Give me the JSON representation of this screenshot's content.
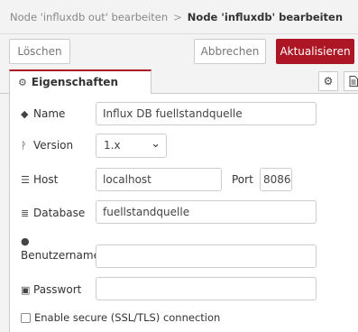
{
  "breadcrumb": {
    "parent": "Node 'influxdb out' bearbeiten",
    "separator": ">",
    "current": "Node 'influxdb' bearbeiten"
  },
  "toolbar": {
    "delete_label": "Löschen",
    "cancel_label": "Abbrechen",
    "update_label": "Aktualisieren"
  },
  "tabs": {
    "properties_label": "Eigenschaften"
  },
  "form": {
    "name_label": "Name",
    "name_value": "Influx DB fuellstandquelle",
    "version_label": "Version",
    "version_value": "1.x",
    "host_label": "Host",
    "host_value": "localhost",
    "port_label": "Port",
    "port_value": "8086",
    "database_label": "Database",
    "database_value": "fuellstandquelle",
    "username_label": "Benutzername",
    "username_value": "",
    "password_label": "Passwort",
    "password_value": "",
    "ssl_label": "Enable secure (SSL/TLS) connection",
    "ssl_checked": false
  },
  "colors": {
    "accent": "#ad1625"
  }
}
